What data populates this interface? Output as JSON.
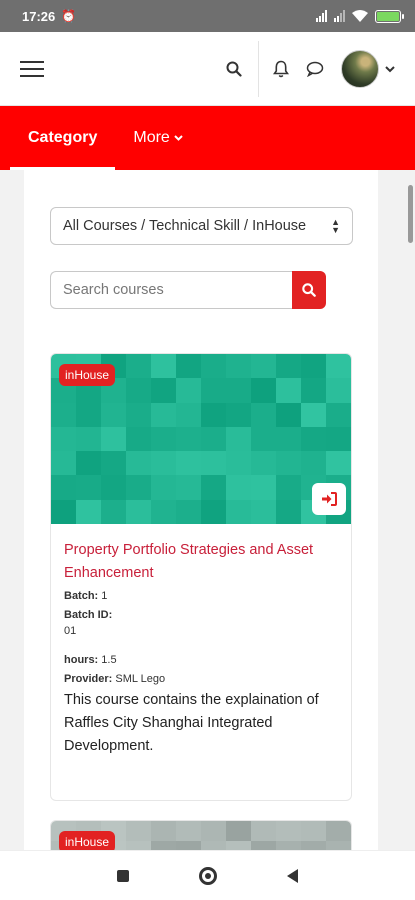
{
  "status_bar": {
    "time": "17:26",
    "alarm_icon": "alarm-icon",
    "battery_color": "#7bd860"
  },
  "navbar": {
    "menu_icon": "hamburger-icon",
    "search_icon": "search-icon",
    "bell_icon": "bell-icon",
    "chat_icon": "chat-icon",
    "avatar": "user-avatar",
    "caret": "⌄"
  },
  "tabs": [
    {
      "label": "Category",
      "active": true
    },
    {
      "label": "More",
      "chevron": "⌄"
    }
  ],
  "filter": {
    "selected": "All Courses / Technical Skill / InHouse"
  },
  "search": {
    "placeholder": "Search courses"
  },
  "courses": [
    {
      "badge": "inHouse",
      "title": "Property Portfolio Strategies and Asset Enhancement",
      "batch_label": "Batch:",
      "batch": "1",
      "batch_id_label": "Batch ID:",
      "batch_id": "01",
      "hours_label": "hours:",
      "hours": "1.5",
      "provider_label": "Provider:",
      "provider": "SML Lego",
      "description": "This course contains the explaination of Raffles City Shanghai Integrated Development.",
      "image_color": "#1fb28f"
    },
    {
      "badge": "inHouse",
      "image_color": "#a9b3b0"
    }
  ],
  "colors": {
    "brand_red": "#ff0000",
    "accent_red": "#e22222",
    "title_red": "#c8203a"
  }
}
